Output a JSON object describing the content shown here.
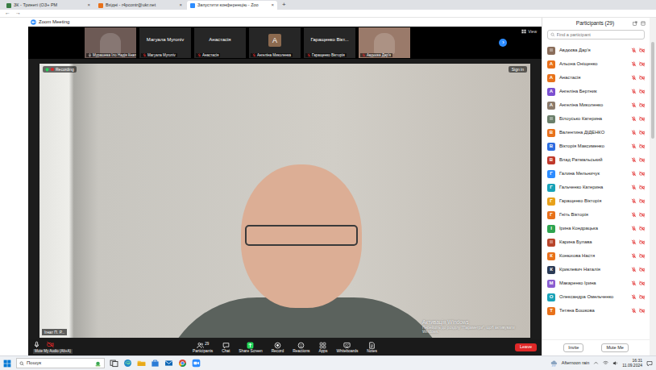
{
  "browser": {
    "tabs": [
      {
        "label": "ЗК - Тринеті (ОЗ+ РМ",
        "selected": false
      },
      {
        "label": "Вхідні - r4pcontr@ukr.net",
        "selected": false
      },
      {
        "label": "Запустити конференцію - Zoo",
        "selected": true
      }
    ],
    "close_glyph": "×",
    "new_tab": "+",
    "back": "←",
    "forward": "→"
  },
  "meeting": {
    "title": "Zoom Meeting",
    "view": "View",
    "next": "›",
    "thumbnails": [
      {
        "kind": "video",
        "name": "Мурашева Іло Надія Кнап",
        "muted": false,
        "color": "#6d5a55"
      },
      {
        "kind": "name",
        "title": "Магуала Myroniv",
        "name": "Магуала Myroniv",
        "muted": true
      },
      {
        "kind": "name",
        "title": "Анастасія",
        "name": "Анастасія",
        "muted": true
      },
      {
        "kind": "avatar",
        "initial": "А",
        "name": "Ангеліна Миколенка",
        "muted": true,
        "color": "#8c6a4f"
      },
      {
        "kind": "name",
        "title": "Гаращенко Вікт...",
        "name": "Гаращенко Вікторія",
        "muted": true
      },
      {
        "kind": "photo",
        "name": "Авдєєва Дар'я",
        "muted": true,
        "color": "#9a7a6a"
      }
    ],
    "recording": "Recording",
    "sign_in": "Sign in",
    "speaker": "Ігнат П. Р...",
    "watermark": {
      "title": "Активація Windows",
      "text": "Перейдіть до розділу \"Параметри\", щоб активувати Windows."
    }
  },
  "toolbar": {
    "tooltip": "Mute My Audio (Alt+A)",
    "audio_muted": false,
    "video_on": false,
    "items": [
      {
        "kind": "participants",
        "label": "Participants",
        "badge": "29"
      },
      {
        "kind": "chat",
        "label": "Chat"
      },
      {
        "kind": "share",
        "label": "Share Screen"
      },
      {
        "kind": "record",
        "label": "Record"
      },
      {
        "kind": "reactions",
        "label": "Reactions"
      },
      {
        "kind": "apps",
        "label": "Apps"
      },
      {
        "kind": "whiteboard",
        "label": "Whiteboards"
      },
      {
        "kind": "notes",
        "label": "Notes"
      }
    ],
    "leave": "Leave"
  },
  "participants": {
    "title": "Participants (29)",
    "search": {
      "placeholder": "Find a participant"
    },
    "items": [
      {
        "name": "Авдєєва Дар'я",
        "kind": "photo",
        "color": "#8a6d5a",
        "muted": true,
        "video_on": false
      },
      {
        "name": "Альона Оніщенко",
        "kind": "letter",
        "initial": "А",
        "color": "#e8711a",
        "muted": true,
        "video_on": false
      },
      {
        "name": "Анастасія",
        "kind": "letter",
        "initial": "А",
        "color": "#e8711a",
        "muted": true,
        "video_on": false
      },
      {
        "name": "Ангеліна Бертник",
        "kind": "letter",
        "initial": "А",
        "color": "#7b4fd0",
        "muted": true,
        "video_on": false
      },
      {
        "name": "Ангеліна Миколенко",
        "kind": "letter",
        "initial": "А",
        "color": "#8c7b6b",
        "muted": true,
        "video_on": false
      },
      {
        "name": "Білоусько Катерина",
        "kind": "photo",
        "color": "#6b7f6a",
        "muted": true,
        "video_on": false
      },
      {
        "name": "Валентина ДІДЕНКО",
        "kind": "letter",
        "initial": "В",
        "color": "#e8711a",
        "muted": true,
        "video_on": false
      },
      {
        "name": "Вікторія Максименко",
        "kind": "letter",
        "initial": "В",
        "color": "#2d6cdf",
        "muted": true,
        "video_on": false
      },
      {
        "name": "Влад Ратмальський",
        "kind": "letter",
        "initial": "В",
        "color": "#c0392b",
        "muted": true,
        "video_on": false
      },
      {
        "name": "Галина Мельничук",
        "kind": "letter",
        "initial": "Г",
        "color": "#2d8cff",
        "muted": true,
        "video_on": false
      },
      {
        "name": "Гальченко Катерина",
        "kind": "letter",
        "initial": "Г",
        "color": "#17a2b8",
        "muted": true,
        "video_on": false
      },
      {
        "name": "Гаращенко Вікторія",
        "kind": "letter",
        "initial": "Г",
        "color": "#e8a11a",
        "muted": true,
        "video_on": false
      },
      {
        "name": "Гніть Вікторія",
        "kind": "letter",
        "initial": "Г",
        "color": "#e8711a",
        "muted": true,
        "video_on": false
      },
      {
        "name": "Ірина Кондрацька",
        "kind": "letter",
        "initial": "І",
        "color": "#2ea44f",
        "muted": true,
        "video_on": false
      },
      {
        "name": "Карина Булава",
        "kind": "photo",
        "color": "#b8442a",
        "muted": true,
        "video_on": false
      },
      {
        "name": "Конюхова Настя",
        "kind": "letter",
        "initial": "К",
        "color": "#e8711a",
        "muted": true,
        "video_on": false
      },
      {
        "name": "Криклевич Наталія",
        "kind": "letter",
        "initial": "К",
        "color": "#2b3a55",
        "muted": true,
        "video_on": false
      },
      {
        "name": "Макаренко Ірина",
        "kind": "letter",
        "initial": "М",
        "color": "#8a5cd0",
        "muted": true,
        "video_on": false
      },
      {
        "name": "Олександра Омельченко",
        "kind": "letter",
        "initial": "О",
        "color": "#17a2b8",
        "muted": true,
        "video_on": false
      },
      {
        "name": "Тетяна Бошкова",
        "kind": "letter",
        "initial": "Т",
        "color": "#e8711a",
        "muted": true,
        "video_on": false
      }
    ],
    "buttons": [
      "Invite",
      "Mute Me"
    ]
  },
  "taskbar": {
    "search": "Пошук",
    "weather": "Afternoon rain",
    "time": "16:31",
    "date": "11.09.2024"
  }
}
